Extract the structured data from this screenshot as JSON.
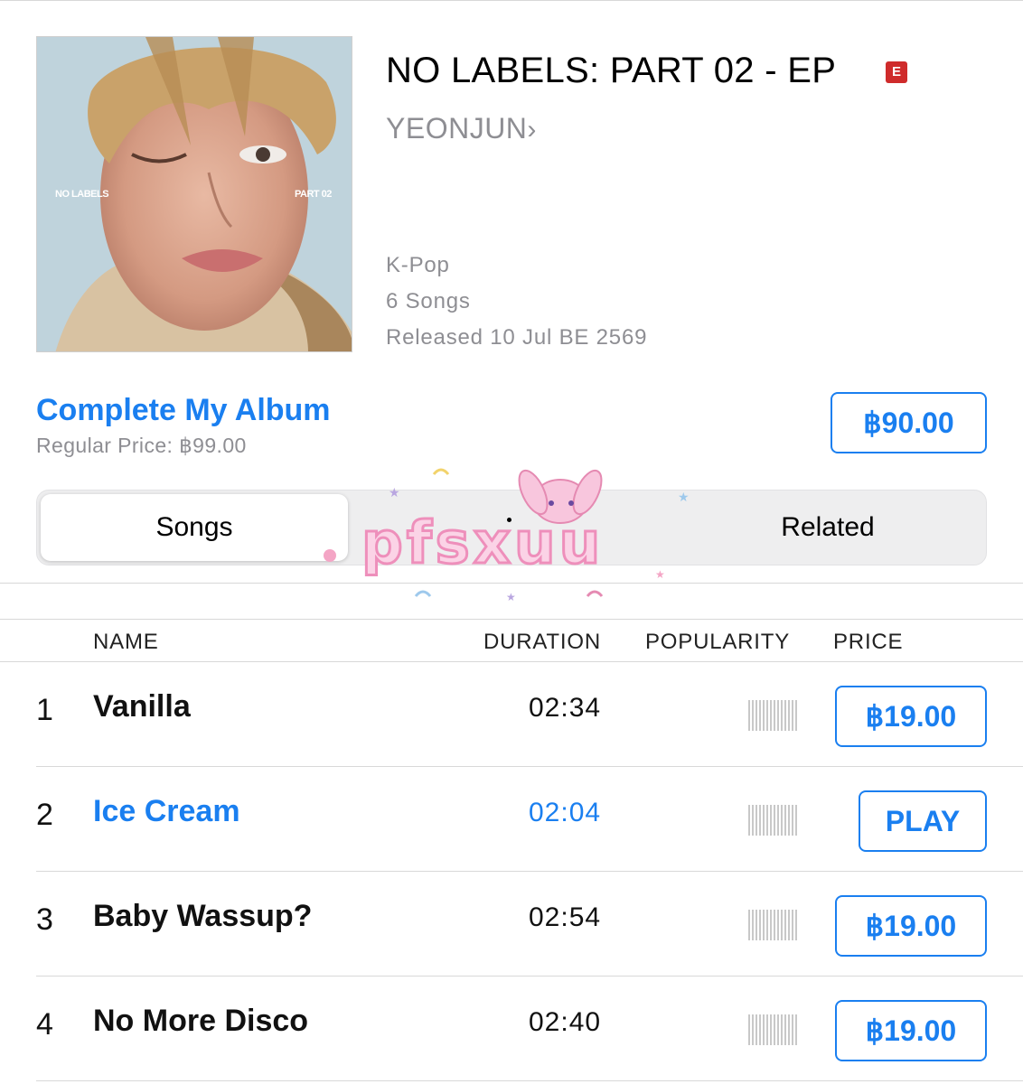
{
  "album": {
    "title": "NO LABELS: PART 02 - EP",
    "explicit_badge": "E",
    "artist": "YEONJUN",
    "artist_chevron": "›",
    "genre": "K-Pop",
    "song_count": "6 Songs",
    "released": "Released 10 Jul BE 2569",
    "art_text_left": "NO LABELS",
    "art_text_right": "PART 02"
  },
  "complete_album": {
    "label": "Complete My Album",
    "regular_price": "Regular Price: ฿99.00",
    "price": "฿90.00"
  },
  "segments": {
    "active": "Songs",
    "other": "Related"
  },
  "sticker_text": "pfsxuu",
  "table": {
    "headers": {
      "name": "NAME",
      "duration": "DURATION",
      "popularity": "POPULARITY",
      "price": "PRICE"
    },
    "rows": [
      {
        "num": "1",
        "name": "Vanilla",
        "duration": "02:34",
        "action": "฿19.00"
      },
      {
        "num": "2",
        "name": "Ice Cream",
        "duration": "02:04",
        "action": "PLAY"
      },
      {
        "num": "3",
        "name": "Baby Wassup?",
        "duration": "02:54",
        "action": "฿19.00"
      },
      {
        "num": "4",
        "name": "No More Disco",
        "duration": "02:40",
        "action": "฿19.00"
      }
    ]
  },
  "colors": {
    "accent": "#1a7ff0",
    "explicit": "#cf2b2b",
    "secondary_text": "#8e8e93"
  }
}
